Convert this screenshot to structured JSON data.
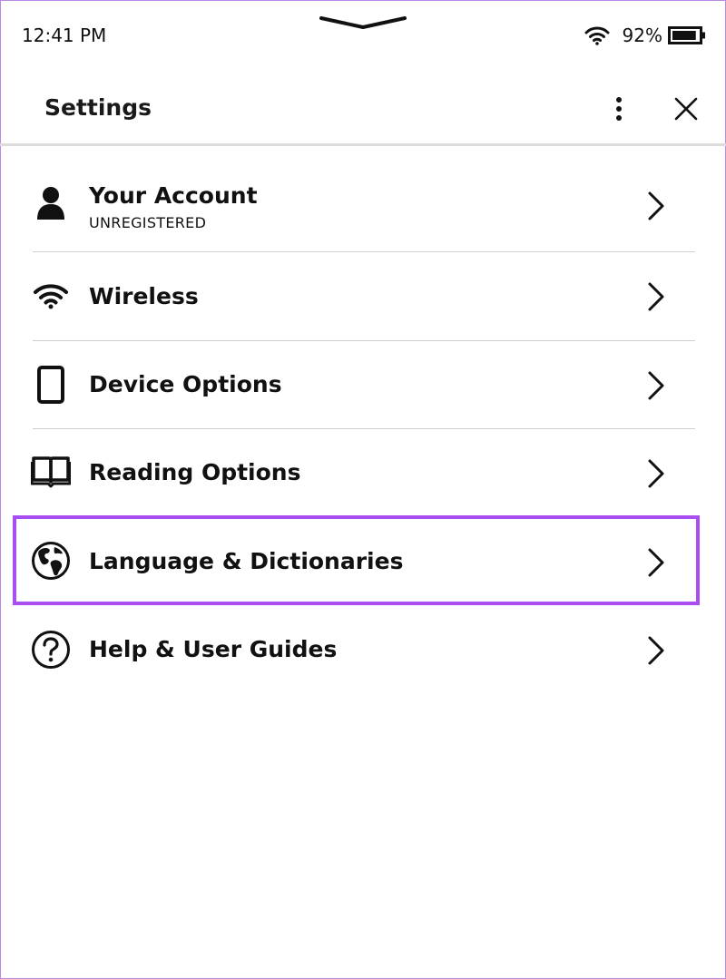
{
  "status_bar": {
    "time": "12:41 PM",
    "battery_percent": "92%",
    "battery_level": 0.92,
    "wifi_icon": "wifi-icon",
    "battery_icon": "battery-icon",
    "handle_icon": "pull-down-handle-icon"
  },
  "header": {
    "title": "Settings",
    "more_icon": "more-vertical-icon",
    "close_icon": "close-icon"
  },
  "settings": {
    "items": [
      {
        "label": "Your Account",
        "sublabel": "UNREGISTERED",
        "icon": "person-icon"
      },
      {
        "label": "Wireless",
        "icon": "wifi-icon"
      },
      {
        "label": "Device Options",
        "icon": "tablet-icon"
      },
      {
        "label": "Reading Options",
        "icon": "open-book-icon"
      },
      {
        "label": "Language & Dictionaries",
        "icon": "globe-icon",
        "highlighted": true
      },
      {
        "label": "Help & User Guides",
        "icon": "help-icon"
      }
    ],
    "chevron_icon": "chevron-right-icon"
  },
  "colors": {
    "highlight": "#a94ef0",
    "text": "#111111",
    "divider": "#cfcfcf",
    "frame": "#b98be6"
  }
}
